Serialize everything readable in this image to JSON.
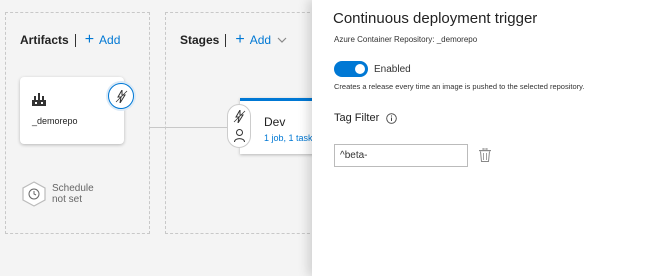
{
  "pipeline": {
    "artifacts": {
      "title": "Artifacts",
      "add_label": "Add",
      "artifact_name": "_demorepo",
      "schedule_line1": "Schedule",
      "schedule_line2": "not set"
    },
    "stages": {
      "title": "Stages",
      "add_label": "Add",
      "stage_name": "Dev",
      "stage_desc": "1 job, 1 task"
    }
  },
  "panel": {
    "title": "Continuous deployment trigger",
    "subtitle": "Azure Container Repository: _demorepo",
    "toggle_label": "Enabled",
    "toggle_on": true,
    "description": "Creates a release every time an image is pushed to the selected repository.",
    "tag_filter_label": "Tag Filter",
    "tag_filter_value": "^beta-"
  },
  "colors": {
    "accent": "#0078d4",
    "background": "#f4f4f4",
    "panel_bg": "#ffffff"
  },
  "icons": [
    "add-icon",
    "chevron-down-icon",
    "build-icon",
    "lightning-icon",
    "schedule-clock-icon",
    "person-icon",
    "info-icon",
    "trash-icon"
  ]
}
